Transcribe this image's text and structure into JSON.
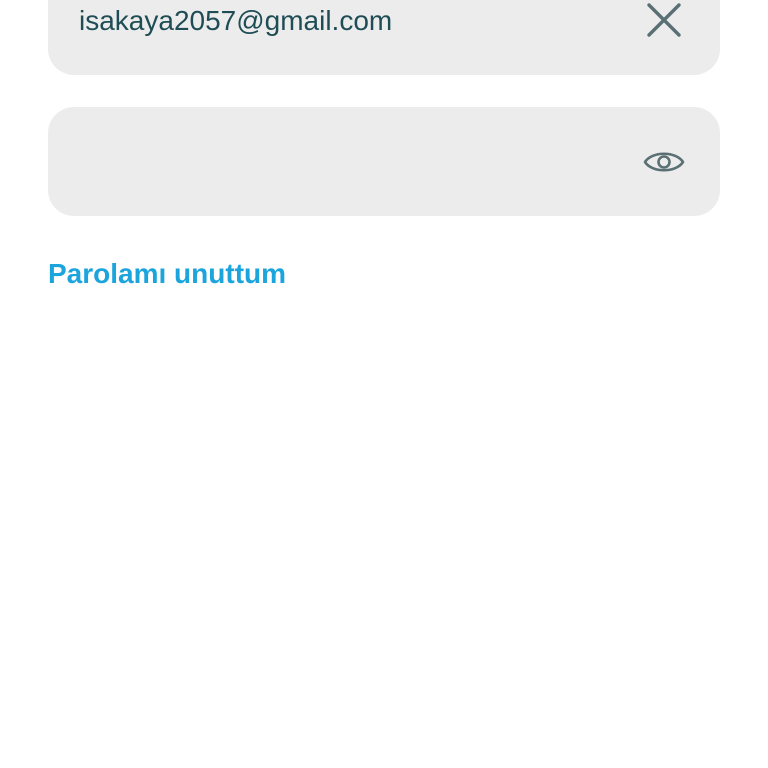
{
  "login_form": {
    "email": {
      "value": "isakaya2057@gmail.com",
      "placeholder": "",
      "clear_icon": "close-icon"
    },
    "password": {
      "value": "",
      "placeholder": "",
      "visibility_icon": "eye-icon"
    },
    "forgot_password_label": "Parolamı unuttum"
  },
  "colors": {
    "field_background": "#ececec",
    "input_text": "#1f4d55",
    "icon": "#5a7074",
    "link": "#1ca4dd",
    "page_background": "#ffffff"
  }
}
